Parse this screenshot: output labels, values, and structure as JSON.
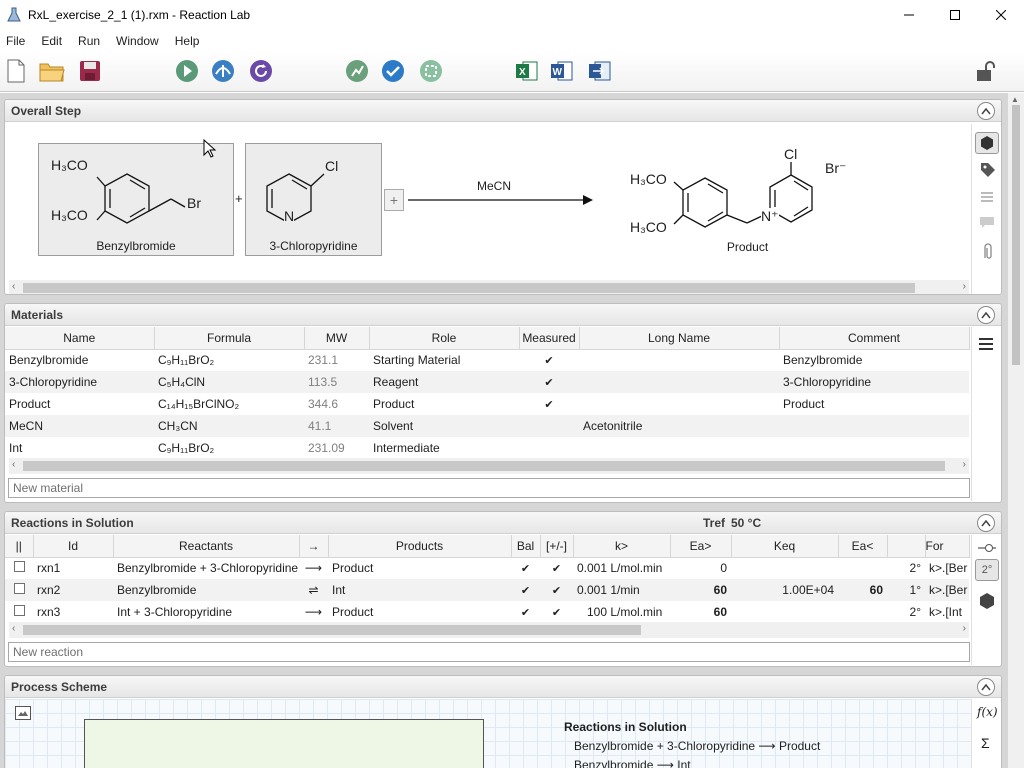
{
  "window": {
    "title": "RxL_exercise_2_1 (1).rxm - Reaction Lab"
  },
  "menu": [
    "File",
    "Edit",
    "Run",
    "Window",
    "Help"
  ],
  "overall_step": {
    "title": "Overall Step",
    "reactants": [
      {
        "name": "Benzylbromide"
      },
      {
        "name": "3-Chloropyridine"
      }
    ],
    "plus": "+",
    "add_button": "+",
    "conditions": "MeCN",
    "product": {
      "name": "Product"
    },
    "atoms": {
      "h3co": "H₃CO",
      "br": "Br",
      "cl": "Cl",
      "n": "N",
      "nplus": "N⁺",
      "brminus": "Br⁻"
    }
  },
  "materials": {
    "title": "Materials",
    "columns": [
      "Name",
      "Formula",
      "MW",
      "Role",
      "Measured",
      "Long Name",
      "Comment"
    ],
    "rows": [
      {
        "name": "Benzylbromide",
        "formula": "C₉H₁₁BrO₂",
        "mw": "231.1",
        "role": "Starting Material",
        "measured": "✔",
        "long_name": "",
        "comment": "Benzylbromide"
      },
      {
        "name": "3-Chloropyridine",
        "formula": "C₅H₄ClN",
        "mw": "113.5",
        "role": "Reagent",
        "measured": "✔",
        "long_name": "",
        "comment": "3-Chloropyridine"
      },
      {
        "name": "Product",
        "formula": "C₁₄H₁₅BrClNO₂",
        "mw": "344.6",
        "role": "Product",
        "measured": "✔",
        "long_name": "",
        "comment": "Product"
      },
      {
        "name": "MeCN",
        "formula": "CH₃CN",
        "mw": "41.1",
        "role": "Solvent",
        "measured": "",
        "long_name": "Acetonitrile",
        "comment": ""
      },
      {
        "name": "Int",
        "formula": "C₉H₁₁BrO₂",
        "mw": "231.09",
        "role": "Intermediate",
        "measured": "",
        "long_name": "",
        "comment": ""
      }
    ],
    "new_placeholder": "New material"
  },
  "reactions": {
    "title": "Reactions in Solution",
    "tref_label": "Tref",
    "tref_value": "50 °C",
    "columns": [
      "||",
      "Id",
      "Reactants",
      "→",
      "Products",
      "Bal",
      "[+/-]",
      "k>",
      "Ea>",
      "Keq",
      "Ea<",
      "",
      "For"
    ],
    "rows": [
      {
        "id": "rxn1",
        "reactants": "Benzylbromide + 3-Chloropyridine",
        "arrow": "⟶",
        "products": "Product",
        "bal": "✔",
        "pm": "✔",
        "k": "0.001",
        "kunit": "L/mol.min",
        "ea_f": "0",
        "ea_f_bold": false,
        "keq": "",
        "ea_r": "",
        "order": "2°",
        "formula": "k>.[Ber"
      },
      {
        "id": "rxn2",
        "reactants": "Benzylbromide",
        "arrow": "⇌",
        "products": "Int",
        "bal": "✔",
        "pm": "✔",
        "k": "0.001",
        "kunit": "1/min",
        "ea_f": "60",
        "ea_f_bold": true,
        "keq": "1.00E+04",
        "ea_r": "60",
        "order": "1°",
        "formula": "k>.[Ber"
      },
      {
        "id": "rxn3",
        "reactants": "Int + 3-Chloropyridine",
        "arrow": "⟶",
        "products": "Product",
        "bal": "✔",
        "pm": "✔",
        "k": "100",
        "kunit": "L/mol.min",
        "ea_f": "60",
        "ea_f_bold": true,
        "keq": "",
        "ea_r": "",
        "order": "2°",
        "formula": "k>.[Int"
      }
    ],
    "new_placeholder": "New reaction",
    "side_badge": "2°"
  },
  "process": {
    "title": "Process Scheme",
    "summary_title": "Reactions in Solution",
    "summary_lines": [
      "Benzylbromide + 3-Chloropyridine ⟶ Product",
      "Benzylbromide ⟶ Int"
    ],
    "tool_fx": "f(x)",
    "tool_sum": "Σ"
  }
}
